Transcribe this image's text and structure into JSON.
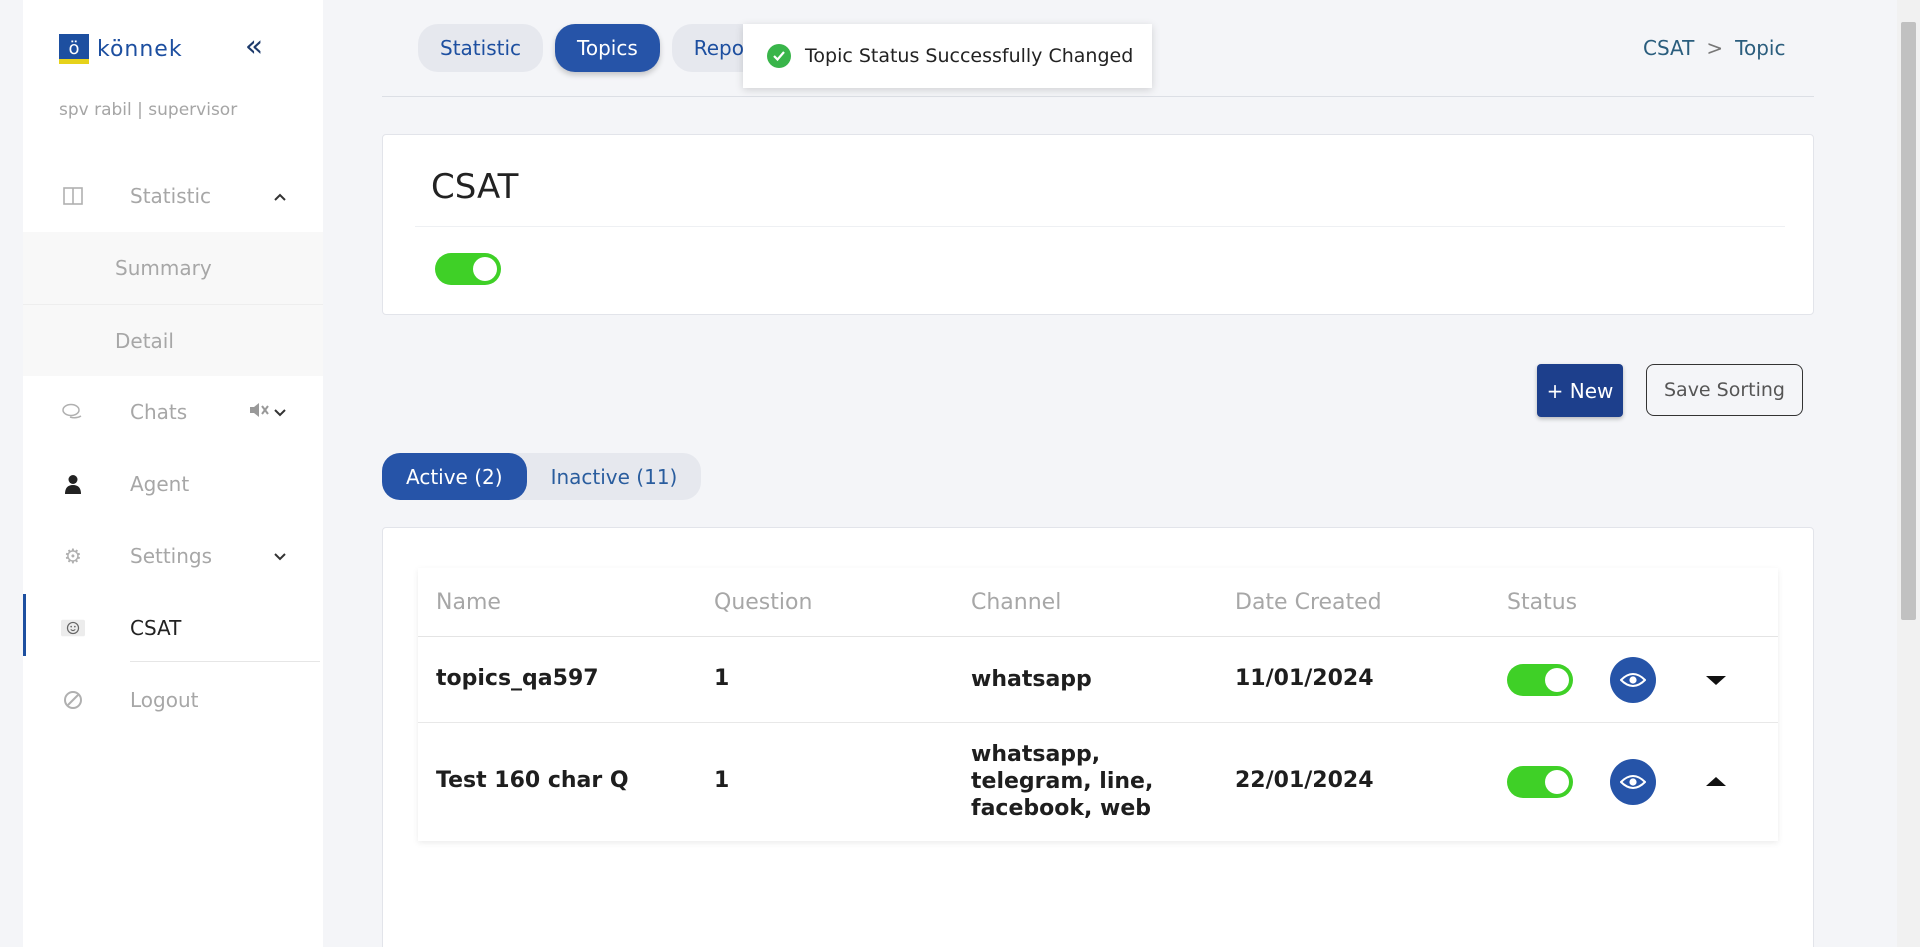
{
  "brand": {
    "logo_mark": "ö",
    "name": "könnek"
  },
  "sidebar": {
    "user": "spv rabil | supervisor",
    "items": [
      {
        "label": "Statistic",
        "icon": "columns-icon",
        "expanded": true,
        "children": [
          {
            "label": "Summary"
          },
          {
            "label": "Detail"
          }
        ]
      },
      {
        "label": "Chats",
        "icon": "chat-bubbles-icon",
        "extra_icon": "muted-speaker-icon"
      },
      {
        "label": "Agent",
        "icon": "person-icon"
      },
      {
        "label": "Settings",
        "icon": "gear-icon"
      },
      {
        "label": "CSAT",
        "icon": "smiley-icon",
        "active": true
      },
      {
        "label": "Logout",
        "icon": "ban-icon"
      }
    ]
  },
  "top_tabs": [
    {
      "label": "Statistic"
    },
    {
      "label": "Topics",
      "active": true
    },
    {
      "label": "Repo"
    }
  ],
  "breadcrumb": {
    "first": "CSAT",
    "separator": ">",
    "second": "Topic"
  },
  "toast": {
    "message": "Topic Status Successfully Changed"
  },
  "csat_card": {
    "title": "CSAT",
    "enabled": true
  },
  "actions": {
    "new_label": "+ New",
    "save_label": "Save Sorting"
  },
  "status_tabs": [
    {
      "label": "Active (2)",
      "active": true
    },
    {
      "label": "Inactive (11)"
    }
  ],
  "table": {
    "headers": [
      "Name",
      "Question",
      "Channel",
      "Date Created",
      "Status"
    ],
    "rows": [
      {
        "name": "topics_qa597",
        "question": "1",
        "channel": "whatsapp",
        "date": "11/01/2024",
        "status": true,
        "caret": "down"
      },
      {
        "name": "Test 160 char Q",
        "question": "1",
        "channel_lines": [
          "whatsapp,",
          "telegram, line,",
          "facebook, web"
        ],
        "date": "22/01/2024",
        "status": true,
        "caret": "up"
      }
    ]
  },
  "colors": {
    "primary": "#2654a8",
    "dark_primary": "#1d3f8c",
    "toggle_on": "#3fd027",
    "success": "#39b54a"
  }
}
